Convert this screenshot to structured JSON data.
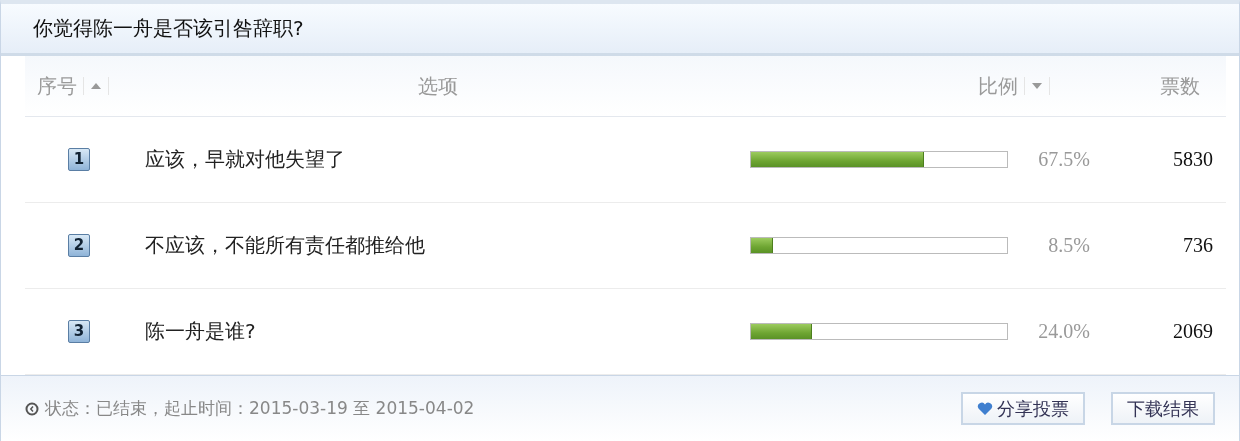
{
  "poll": {
    "title": "你觉得陈一舟是否该引咎辞职?"
  },
  "table": {
    "columns": [
      {
        "label": "序号",
        "sorted": true,
        "descending": false
      },
      {
        "label": "选项",
        "sorted": false
      },
      {
        "label": "比例",
        "sorted": true,
        "descending": true
      },
      {
        "label": "票数",
        "sorted": false
      }
    ],
    "rows": [
      {
        "index": "1",
        "option": "应该，早就对他失望了",
        "level": 0.675,
        "percent": "67.5%",
        "votes": "5830"
      },
      {
        "index": "2",
        "option": "不应该，不能所有责任都推给他",
        "level": 0.085,
        "percent": "8.5%",
        "votes": "736"
      },
      {
        "index": "3",
        "option": "陈一舟是谁?",
        "level": 0.24,
        "percent": "24.0%",
        "votes": "2069"
      }
    ]
  },
  "footer": {
    "status": "状态：已结束，起止时间：2015-03-19 至 2015-04-02",
    "buttons": [
      {
        "label": "分享投票",
        "kind": "share"
      },
      {
        "label": "下载结果",
        "kind": "plain"
      }
    ]
  }
}
